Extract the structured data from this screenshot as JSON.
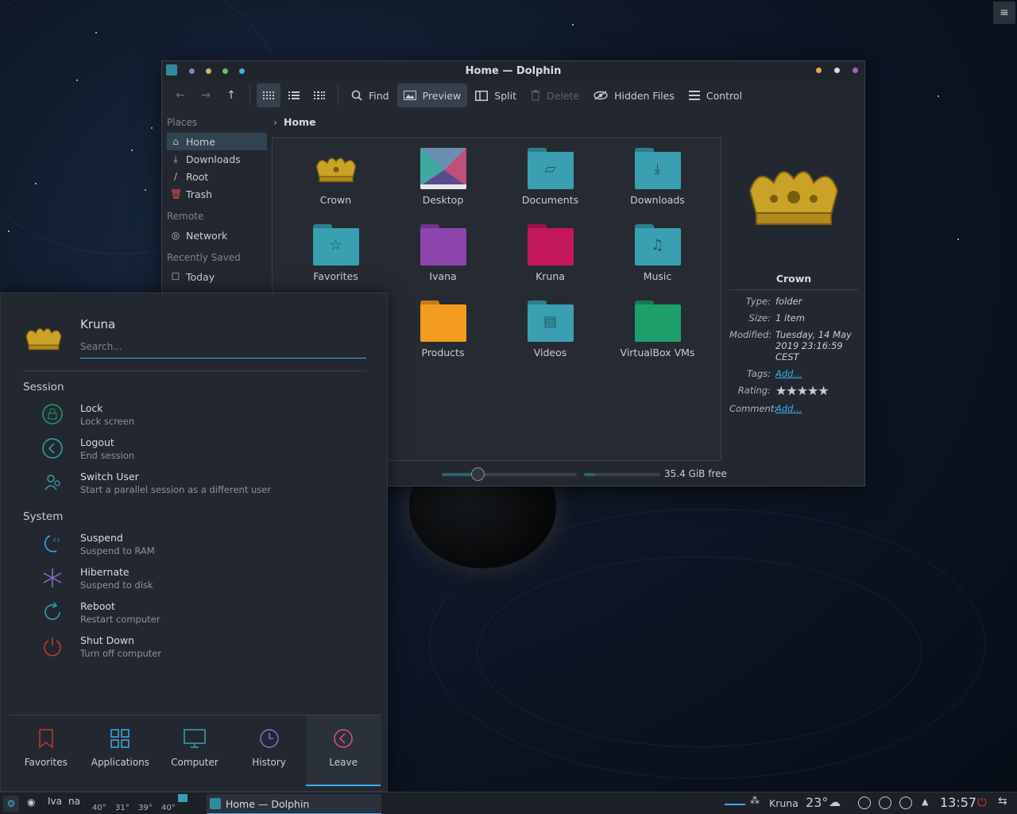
{
  "desktop": {
    "menu_glyph": "≡"
  },
  "dolphin": {
    "title": "Home — Dolphin",
    "toolbar": {
      "back_icon": "←",
      "forward_icon": "→",
      "up_icon": "↑",
      "find": "Find",
      "preview": "Preview",
      "split": "Split",
      "delete": "Delete",
      "hidden_files": "Hidden Files",
      "control": "Control"
    },
    "places": {
      "header_places": "Places",
      "header_remote": "Remote",
      "header_recent": "Recently Saved",
      "home": "Home",
      "downloads": "Downloads",
      "root": "Root",
      "trash": "Trash",
      "network": "Network",
      "today": "Today"
    },
    "breadcrumb": {
      "current": "Home"
    },
    "items": [
      {
        "name": "Crown"
      },
      {
        "name": "Desktop"
      },
      {
        "name": "Documents"
      },
      {
        "name": "Downloads"
      },
      {
        "name": "Favorites"
      },
      {
        "name": "Ivana"
      },
      {
        "name": "Kruna"
      },
      {
        "name": "Music"
      },
      {
        "name": "Products"
      },
      {
        "name": "Videos"
      },
      {
        "name": "VirtualBox VMs"
      }
    ],
    "colors": {
      "teal_folder": "#3a9fb0",
      "purple_folder": "#8e44ad",
      "magenta_folder": "#c2185b",
      "orange_folder": "#f39c1f",
      "green_folder": "#1e9e6a",
      "accent": "#3daee9"
    },
    "info": {
      "name": "Crown",
      "type_label": "Type:",
      "type_value": "folder",
      "size_label": "Size:",
      "size_value": "1 item",
      "modified_label": "Modified:",
      "modified_value": "Tuesday, 14 May 2019 23:16:59 CEST",
      "tags_label": "Tags:",
      "tags_value": "Add...",
      "rating_label": "Rating:",
      "rating_value": "★★★★★",
      "comment_label": "Comment:",
      "comment_value": "Add..."
    },
    "status": {
      "free_space": "35.4 GiB free"
    }
  },
  "launcher": {
    "user": "Kruna",
    "search_placeholder": "Search...",
    "session_header": "Session",
    "system_header": "System",
    "session": [
      {
        "title": "Lock",
        "subtitle": "Lock screen"
      },
      {
        "title": "Logout",
        "subtitle": "End session"
      },
      {
        "title": "Switch User",
        "subtitle": "Start a parallel session as a different user"
      }
    ],
    "system": [
      {
        "title": "Suspend",
        "subtitle": "Suspend to RAM"
      },
      {
        "title": "Hibernate",
        "subtitle": "Suspend to disk"
      },
      {
        "title": "Reboot",
        "subtitle": "Restart computer"
      },
      {
        "title": "Shut Down",
        "subtitle": "Turn off computer"
      }
    ],
    "tabs": [
      "Favorites",
      "Applications",
      "Computer",
      "History",
      "Leave"
    ]
  },
  "taskbar": {
    "pager_1": "Iva",
    "pager_2": "na",
    "cpu_temps": [
      "40°",
      "31°",
      "39°",
      "40°"
    ],
    "task_title": "Home — Dolphin",
    "weather_place": "Kruna",
    "temperature": "23°",
    "clock": "13:57"
  }
}
